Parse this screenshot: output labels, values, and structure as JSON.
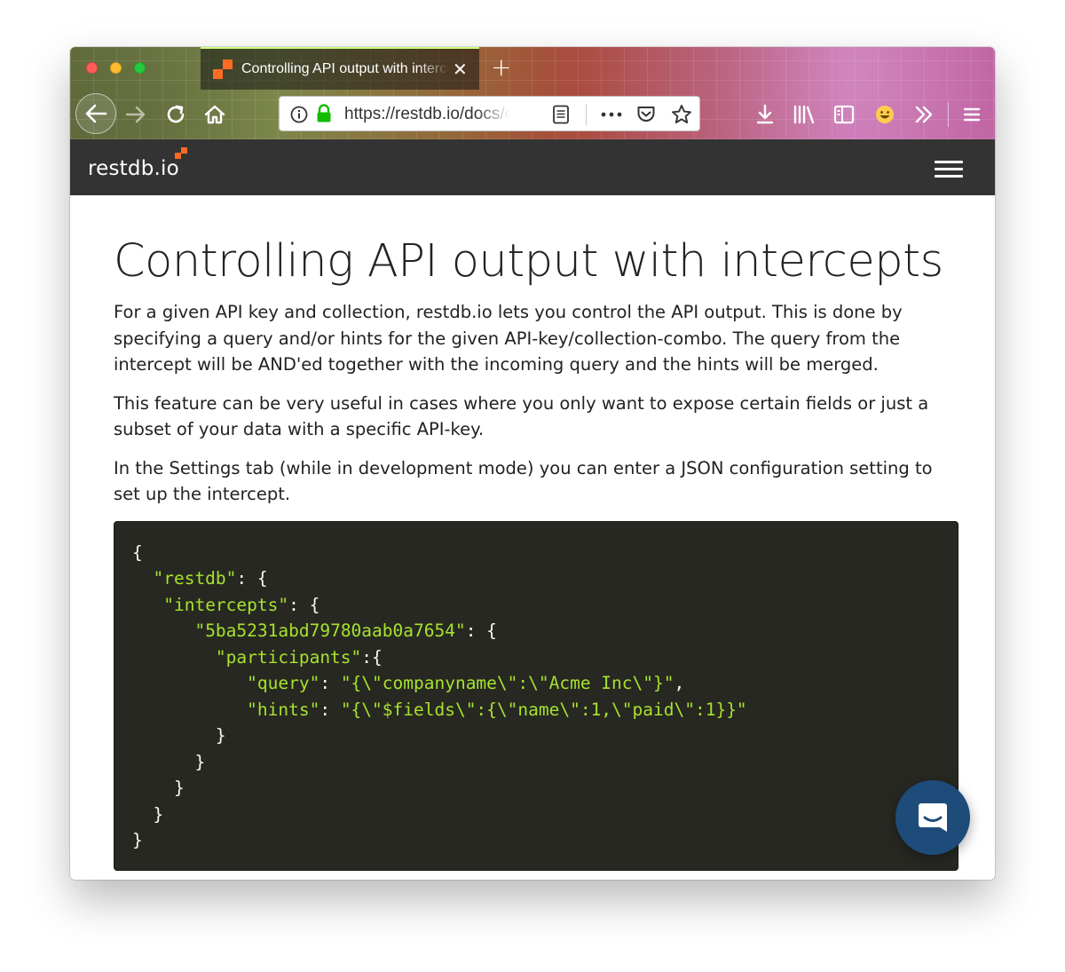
{
  "browser": {
    "tab": {
      "title": "Controlling API output with intercepts"
    },
    "url": "https://restdb.io/docs/controlling-api-output-with-intercepts"
  },
  "site": {
    "logo": "restdb.io"
  },
  "article": {
    "title": "Controlling API output with intercepts",
    "paragraphs": [
      "For a given API key and collection, restdb.io lets you control the API output. This is done by specifying a query and/or hints for the given API-key/collection-combo. The query from the intercept will be AND'ed together with the incoming query and the hints will be merged.",
      "This feature can be very useful in cases where you only want to expose certain fields or just a subset of your data with a specific API-key.",
      "In the Settings tab (while in development mode) you can enter a JSON configuration setting to set up the intercept."
    ],
    "code": {
      "lines": [
        {
          "pre": "{",
          "str": "",
          "post": ""
        },
        {
          "pre": "  ",
          "str": "\"restdb\"",
          "post": ": {"
        },
        {
          "pre": "   ",
          "str": "\"intercepts\"",
          "post": ": {"
        },
        {
          "pre": "      ",
          "str": "\"5ba5231abd79780aab0a7654\"",
          "post": ": {"
        },
        {
          "pre": "        ",
          "str": "\"participants\"",
          "post": ":{"
        },
        {
          "pre": "           ",
          "str": "\"query\"",
          "post": ": ",
          "str2": "\"{\\\"companyname\\\":\\\"Acme Inc\\\"}\"",
          "post2": ","
        },
        {
          "pre": "           ",
          "str": "\"hints\"",
          "post": ": ",
          "str2": "\"{\\\"$fields\\\":{\\\"name\\\":1,\\\"paid\\\":1}}\"",
          "post2": ""
        },
        {
          "pre": "        }",
          "str": "",
          "post": ""
        },
        {
          "pre": "      }",
          "str": "",
          "post": ""
        },
        {
          "pre": "    }",
          "str": "",
          "post": ""
        },
        {
          "pre": "  }",
          "str": "",
          "post": ""
        },
        {
          "pre": "}",
          "str": "",
          "post": ""
        }
      ]
    }
  },
  "colors": {
    "header_bg": "#333333",
    "code_bg": "#272822",
    "code_string": "#a6e22e",
    "brand_orange": "#ff6b23",
    "chat_button": "#1e4c7a"
  }
}
